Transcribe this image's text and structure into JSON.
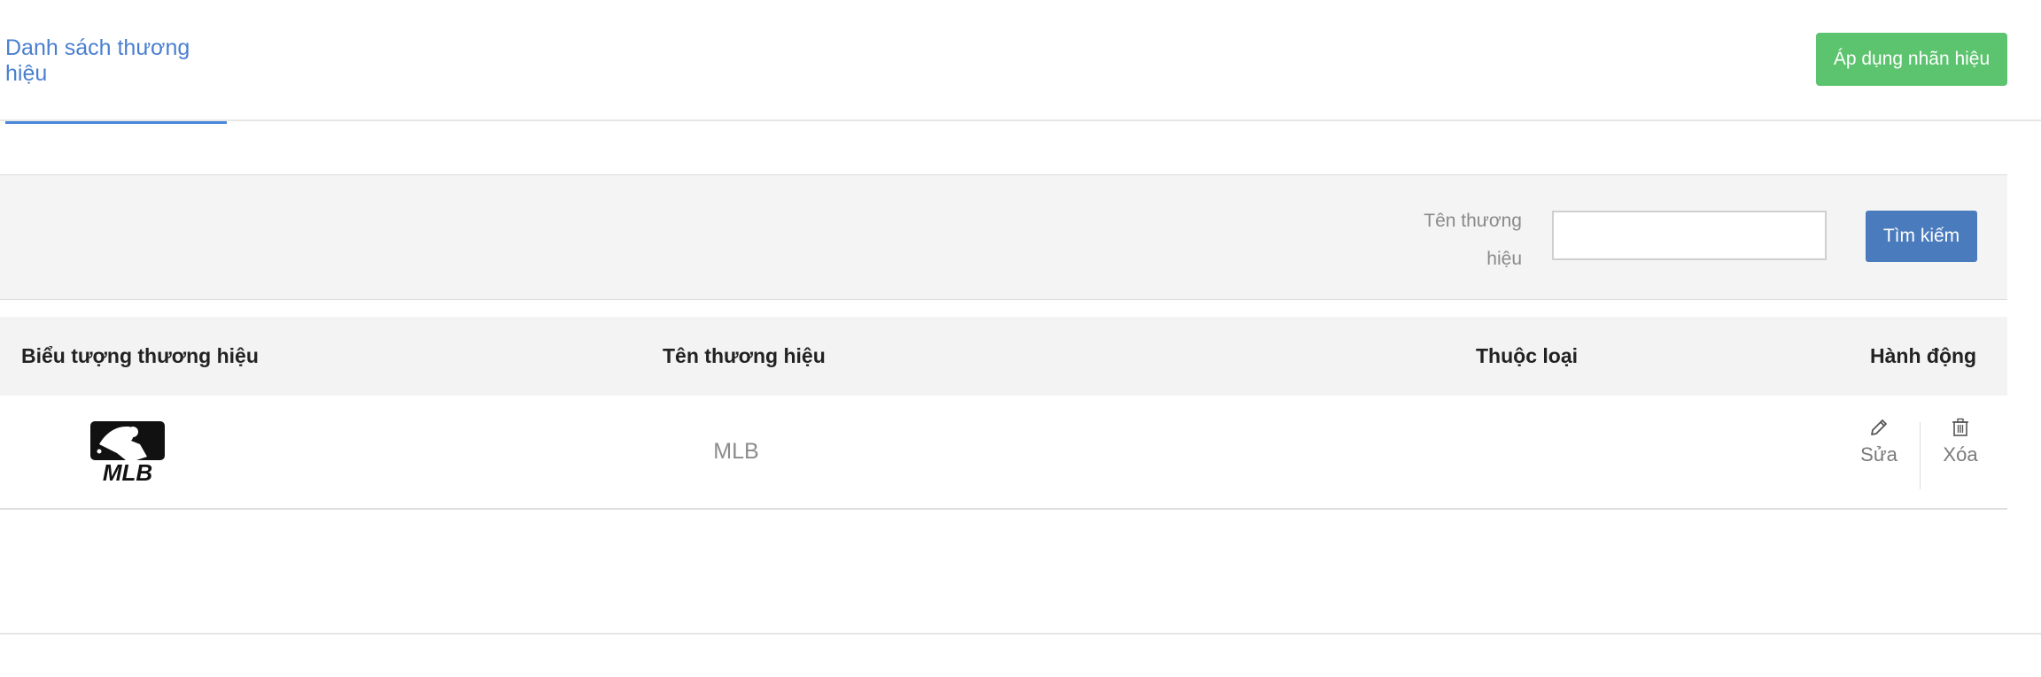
{
  "tabs": {
    "active_label": "Danh sách thương hiệu"
  },
  "toolbar": {
    "apply_label": "Áp dụng nhãn hiệu"
  },
  "search": {
    "label_line1": "Tên thương",
    "label_line2": "hiệu",
    "value": "",
    "placeholder": "",
    "button_label": "Tìm kiếm"
  },
  "table": {
    "columns": [
      "Biểu tượng thương hiệu",
      "Tên thương hiệu",
      "Thuộc loại",
      "Hành động"
    ],
    "rows": [
      {
        "logo_icon": "mlb-logo",
        "logo_text": "MLB",
        "name": "MLB",
        "category": "",
        "edit_label": "Sửa",
        "delete_label": "Xóa"
      }
    ]
  },
  "colors": {
    "primary": "#4a7bbd",
    "success": "#5cc36e",
    "tab_accent": "#4a86dc"
  }
}
